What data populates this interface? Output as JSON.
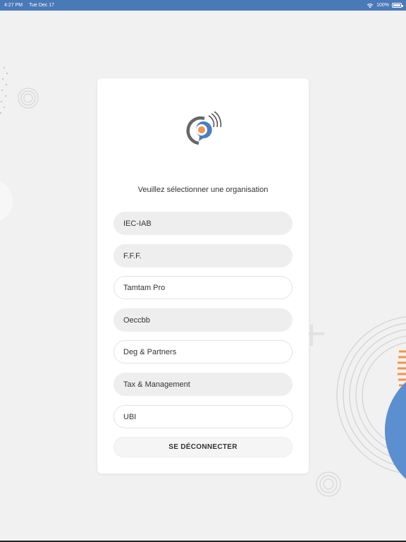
{
  "status_bar": {
    "time": "4:27 PM",
    "date": "Tue Dec 17",
    "battery": "100%",
    "icons": [
      "wifi-icon",
      "battery-icon"
    ]
  },
  "colors": {
    "status_bar": "#4a79b8",
    "background": "#f1f1f2",
    "accent_orange": "#f0954b",
    "accent_blue": "#5b8fcf"
  },
  "logo": {
    "icon": "chat-signal-logo"
  },
  "prompt": "Veuillez sélectionner une organisation",
  "organizations": [
    {
      "label": "IEC-IAB",
      "style": "filled"
    },
    {
      "label": "F.F.F.",
      "style": "filled"
    },
    {
      "label": "Tamtam Pro",
      "style": "outlined"
    },
    {
      "label": "Oeccbb",
      "style": "filled"
    },
    {
      "label": "Deg & Partners",
      "style": "outlined"
    },
    {
      "label": "Tax & Management",
      "style": "filled"
    },
    {
      "label": "UBI",
      "style": "outlined"
    }
  ],
  "logout_label": "SE DÉCONNECTER"
}
